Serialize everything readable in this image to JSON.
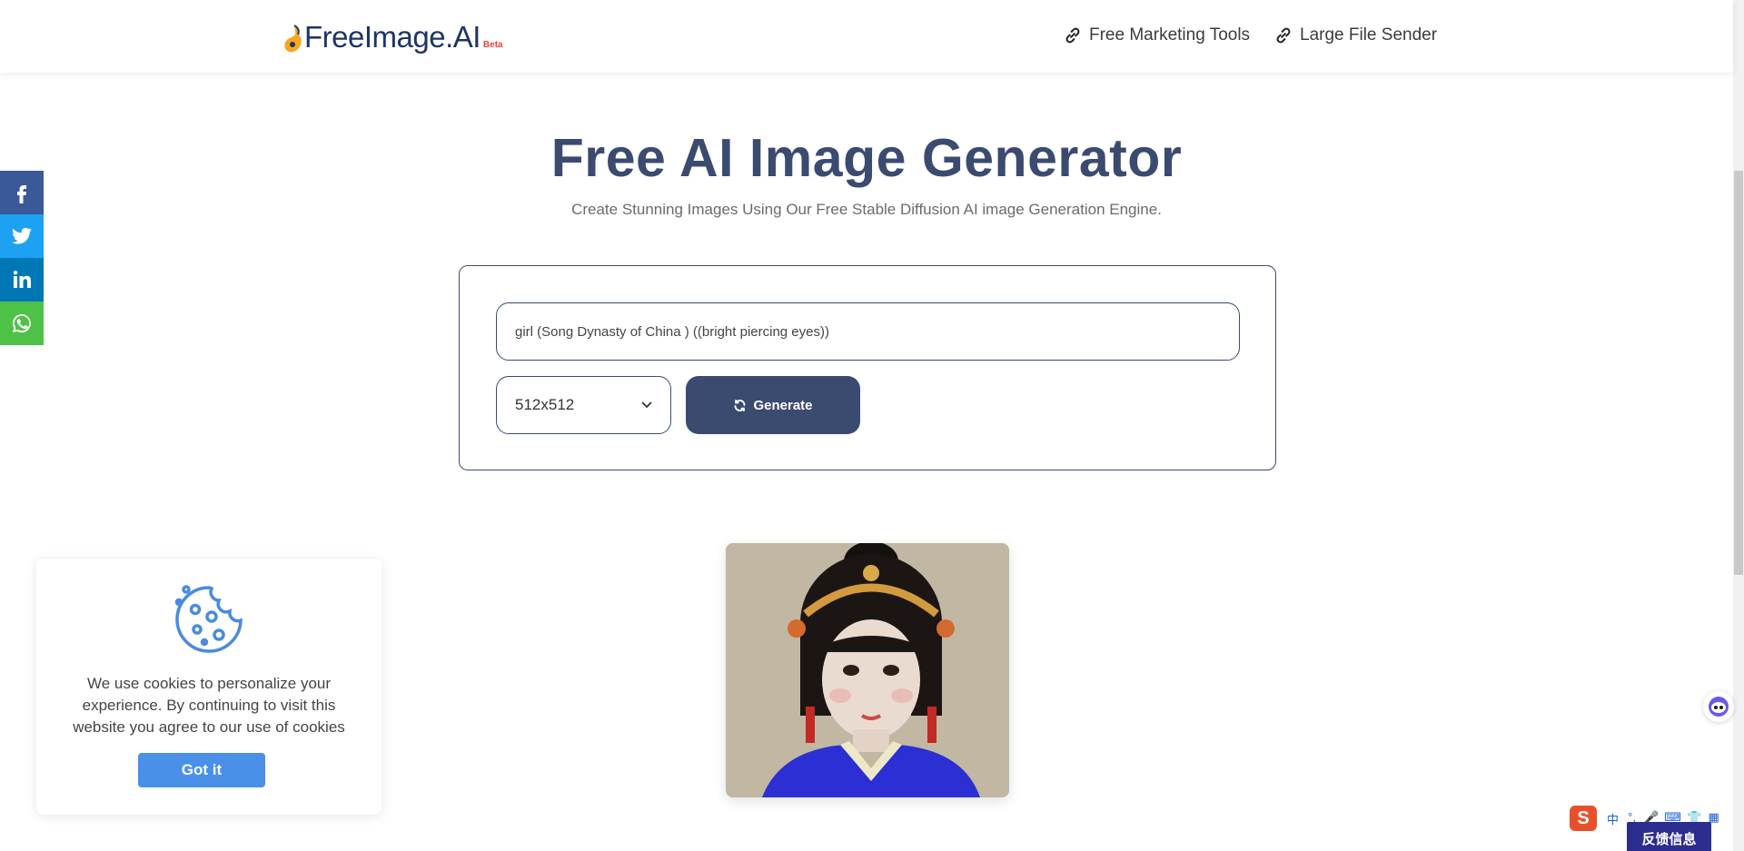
{
  "header": {
    "logo_text": "FreeImage.AI",
    "logo_badge": "Beta",
    "nav": [
      {
        "label": "Free Marketing Tools",
        "icon": "link-icon"
      },
      {
        "label": "Large File Sender",
        "icon": "link-icon"
      }
    ]
  },
  "social": [
    {
      "name": "facebook",
      "color": "#3b5998"
    },
    {
      "name": "twitter",
      "color": "#1da1f2"
    },
    {
      "name": "linkedin",
      "color": "#0077b5"
    },
    {
      "name": "whatsapp",
      "color": "#4dc247"
    }
  ],
  "hero": {
    "title": "Free AI Image Generator",
    "subtitle": "Create Stunning Images Using Our Free Stable Diffusion AI image Generation Engine."
  },
  "form": {
    "prompt_value": "girl (Song Dynasty of China ) ((bright piercing eyes))",
    "size_selected": "512x512",
    "generate_label": "Generate"
  },
  "cookie": {
    "message": "We use cookies to personalize your experience. By continuing to visit this website you agree to our use of cookies",
    "button_label": "Got it"
  },
  "ime": {
    "logo": "S",
    "items": [
      "中",
      "°,",
      "🎤",
      "⌨",
      "👕",
      "▦"
    ]
  },
  "feedback_label": "反馈信息",
  "colors": {
    "primary": "#3b4b70",
    "cookie_button": "#4a90e8",
    "logo_text": "#1f3565",
    "beta_badge": "#e8433f"
  }
}
